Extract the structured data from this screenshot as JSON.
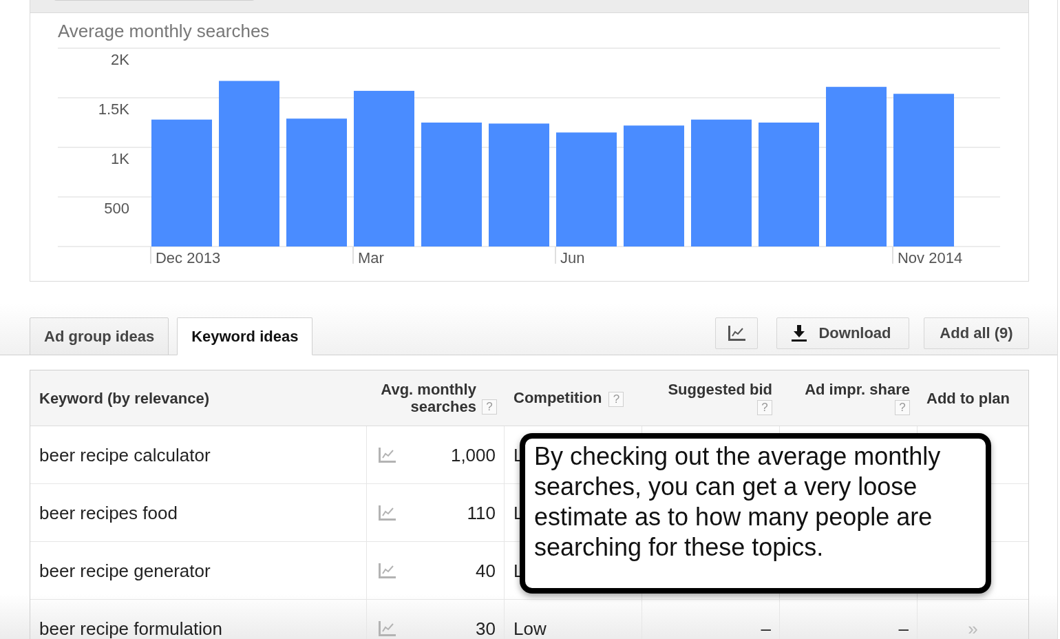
{
  "chart_panel": {
    "title": "Average monthly searches",
    "chart_data": {
      "type": "bar",
      "grid": true,
      "categories": [
        "Dec 2013",
        null,
        null,
        "Mar",
        null,
        null,
        "Jun",
        null,
        null,
        null,
        null,
        "Nov 2014"
      ],
      "values": [
        1280,
        1670,
        1290,
        1570,
        1250,
        1240,
        1150,
        1220,
        1280,
        1250,
        1610,
        1540
      ],
      "ylim": [
        0,
        2000
      ],
      "yticks": [
        {
          "value": 500,
          "label": "500"
        },
        {
          "value": 1000,
          "label": "1K"
        },
        {
          "value": 1500,
          "label": "1.5K"
        },
        {
          "value": 2000,
          "label": "2K"
        }
      ]
    }
  },
  "tabs": [
    {
      "label": "Ad group ideas",
      "selected": false
    },
    {
      "label": "Keyword ideas",
      "selected": true
    }
  ],
  "toolbar": [
    {
      "kind": "chart"
    },
    {
      "kind": "download",
      "label": "Download"
    },
    {
      "kind": "plain",
      "label": "Add all (9)"
    }
  ],
  "table": {
    "columns": [
      {
        "kind": "keyword",
        "label": "Keyword (by relevance)"
      },
      {
        "kind": "volume",
        "label": "Avg. monthly searches",
        "help": "?"
      },
      {
        "kind": "competition",
        "label": "Competition",
        "help": "?"
      },
      {
        "kind": "bid",
        "label": "Suggested bid",
        "help": "?"
      },
      {
        "kind": "share",
        "label": "Ad impr. share",
        "help": "?"
      },
      {
        "kind": "action",
        "label": "Add to plan"
      }
    ],
    "rows": [
      {
        "keyword": "beer recipe calculator",
        "searches": "1,000",
        "competition": "L"
      },
      {
        "keyword": "beer recipes food",
        "searches": "110",
        "competition": "L"
      },
      {
        "keyword": "beer recipe generator",
        "searches": "40",
        "competition": "L"
      },
      {
        "keyword": "beer recipe formulation",
        "searches": "30",
        "competition": "Low",
        "suggested_bid": "–",
        "ad_impr_share": "–",
        "add_to_plan": "»"
      }
    ]
  },
  "callout": {
    "text": "By checking out the average monthly searches, you can get a very loose estimate as to how many people are searching for these topics."
  }
}
